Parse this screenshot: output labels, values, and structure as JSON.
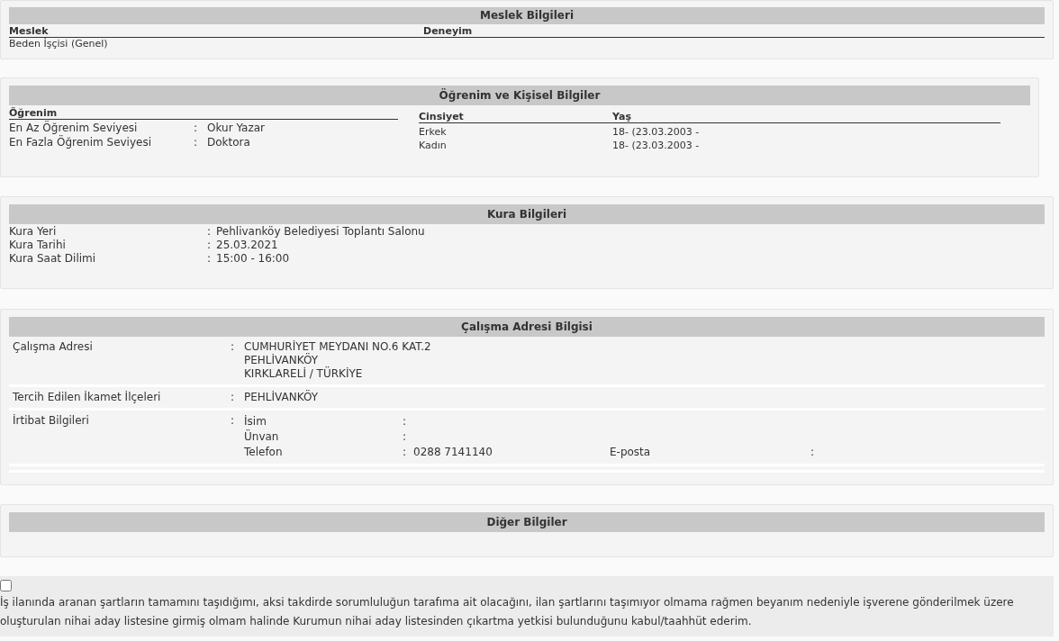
{
  "occupation": {
    "title": "Meslek Bilgileri",
    "columns": [
      "Meslek",
      "Deneyim"
    ],
    "rows": [
      [
        "Beden İşçisi (Genel)"
      ]
    ]
  },
  "education": {
    "title": "Öğrenim ve Kişisel Bilgiler",
    "heading": "Öğrenim",
    "rows": [
      {
        "label": "En Az Öğrenim Seviyesi",
        "colon": ":",
        "value": "Okur Yazar"
      },
      {
        "label": "En Fazla Öğrenim Seviyesi",
        "colon": ":",
        "value": "Doktora"
      }
    ],
    "personal_columns": [
      "Cinsiyet",
      "Yaş"
    ],
    "personal_rows": [
      [
        "Erkek",
        "18- (23.03.2003 -"
      ],
      [
        "Kadın",
        "18- (23.03.2003 -"
      ]
    ]
  },
  "lottery": {
    "title": "Kura Bilgileri",
    "rows": [
      {
        "label": "Kura Yeri",
        "colon": ":",
        "value": "Pehlivanköy Belediyesi Toplantı Salonu"
      },
      {
        "label": "Kura Tarihi",
        "colon": ":",
        "value": "25.03.2021"
      },
      {
        "label": "Kura Saat Dilimi",
        "colon": ":",
        "value": "15:00 - 16:00"
      }
    ]
  },
  "work_address": {
    "title": "Çalışma Adresi Bilgisi",
    "address_label": "Çalışma Adresi",
    "address_colon": ":",
    "address_lines": [
      "CUMHURİYET MEYDANI NO.6 KAT.2",
      "PEHLİVANKÖY",
      "KIRKLARELİ / TÜRKİYE"
    ],
    "districts_label": "Tercih Edilen İkamet İlçeleri",
    "districts_colon": ":",
    "districts": "PEHLİVANKÖY",
    "contact_label": "İrtibat Bilgileri",
    "contact_colon": ":",
    "contact": [
      {
        "label": "İsim",
        "colon": ":"
      },
      {
        "label": "Ünvan",
        "colon": ":"
      },
      {
        "label": "Telefon",
        "colon": ":",
        "value": "0288 7141140",
        "extra_label": "E-posta",
        "extra_colon": ":"
      }
    ]
  },
  "other": {
    "title": "Diğer Bilgiler"
  },
  "declaration": {
    "checked": false,
    "text": "İş ilanında aranan şartların tamamını taşıdığımı, aksi takdirde sorumluluğun tarafıma ait olacağını, ilan şartlarını taşımıyor olmama rağmen beyanım nedeniyle işverene gönderilmek üzere oluşturulan nihai aday listesine girmiş olmam halinde Kurumun nihai aday listesinden çıkartma yetkisi bulunduğunu kabul/taahhüt ederim."
  }
}
